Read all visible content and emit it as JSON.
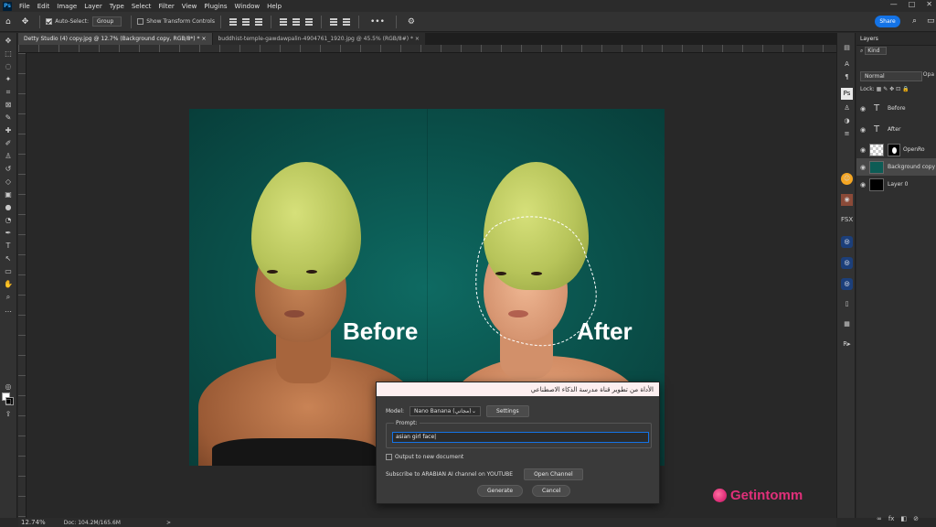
{
  "app": {
    "logo_text": "Ps",
    "menu": [
      "File",
      "Edit",
      "Image",
      "Layer",
      "Type",
      "Select",
      "Filter",
      "View",
      "Plugins",
      "Window",
      "Help"
    ],
    "window_controls": [
      "—",
      "□",
      "✕"
    ]
  },
  "options_bar": {
    "auto_select_label": "Auto-Select:",
    "auto_select_checked": true,
    "auto_select_value": "Group",
    "show_transform_label": "Show Transform Controls",
    "show_transform_checked": false,
    "more_label": "•••",
    "share_label": "Share"
  },
  "tabs": [
    {
      "label": "Detty Studio (4) copy.jpg @ 12.7% (Background copy, RGB/8*) *  ×",
      "active": true
    },
    {
      "label": "buddhist-temple-gawdawpalin-4904761_1920.jpg @ 45.5% (RGB/8#) *  ×",
      "active": false
    }
  ],
  "canvas": {
    "before_label": "Before",
    "after_label": "After"
  },
  "dialog": {
    "title": "الأداة من تطوير قناة مدرسة الذكاء الاصطناعي",
    "model_label": "Model:",
    "model_value": "Nano Banana (مجاني)",
    "settings_label": "Settings",
    "prompt_label": "Prompt:",
    "prompt_value": "asian girl face|",
    "output_new_doc_label": "Output to new document",
    "output_new_doc_checked": false,
    "subscribe_text": "Subscribe to ARABIAN AI channel on YOUTUBE",
    "open_channel_label": "Open Channel",
    "generate_label": "Generate",
    "cancel_label": "Cancel"
  },
  "layers_panel": {
    "title": "Layers",
    "filter_kind": "Kind",
    "blend_mode": "Normal",
    "opacity_label": "Opa",
    "lock_label": "Lock:",
    "layers": [
      {
        "name": "Before",
        "type": "text",
        "selected": false
      },
      {
        "name": "After",
        "type": "text",
        "selected": false
      },
      {
        "name": "OpenRo",
        "type": "smart",
        "selected": false
      },
      {
        "name": "Background copy",
        "type": "image",
        "selected": true
      },
      {
        "name": "Layer 0",
        "type": "image",
        "selected": false
      }
    ],
    "bottom_icons": [
      "fx",
      "◧",
      "⊘"
    ]
  },
  "status": {
    "zoom": "12.74%",
    "doc": "Doc: 104.2M/165.6M",
    "arrow": ">"
  },
  "right_strip_labels": {
    "fsx": "FSX",
    "rb": "R▸"
  },
  "watermark": {
    "text": "Getintomm"
  }
}
